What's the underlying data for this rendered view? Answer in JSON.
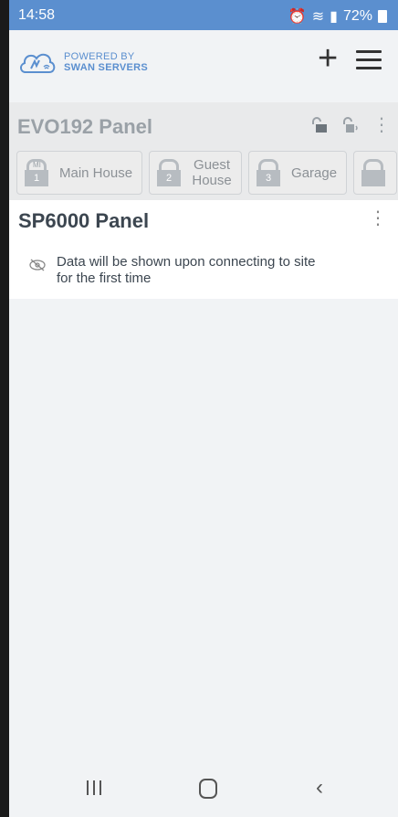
{
  "status": {
    "time": "14:58",
    "battery": "72%"
  },
  "brand": {
    "line1": "POWERED BY",
    "line2": "SWAN SERVERS",
    "color": "#5b8fcf"
  },
  "panels": [
    {
      "title": "EVO192 Panel",
      "areas": [
        {
          "num": "1",
          "badge": "MI",
          "label": "Main House"
        },
        {
          "num": "2",
          "label": "Guest House"
        },
        {
          "num": "3",
          "label": "Garage"
        }
      ]
    },
    {
      "title": "SP6000 Panel",
      "message": "Data will be shown upon connecting to site for the first time"
    }
  ],
  "icons": {
    "add": "plus-icon",
    "menu": "hamburger-menu-icon",
    "more": "more-vert-icon",
    "hidden": "eye-off-icon"
  }
}
